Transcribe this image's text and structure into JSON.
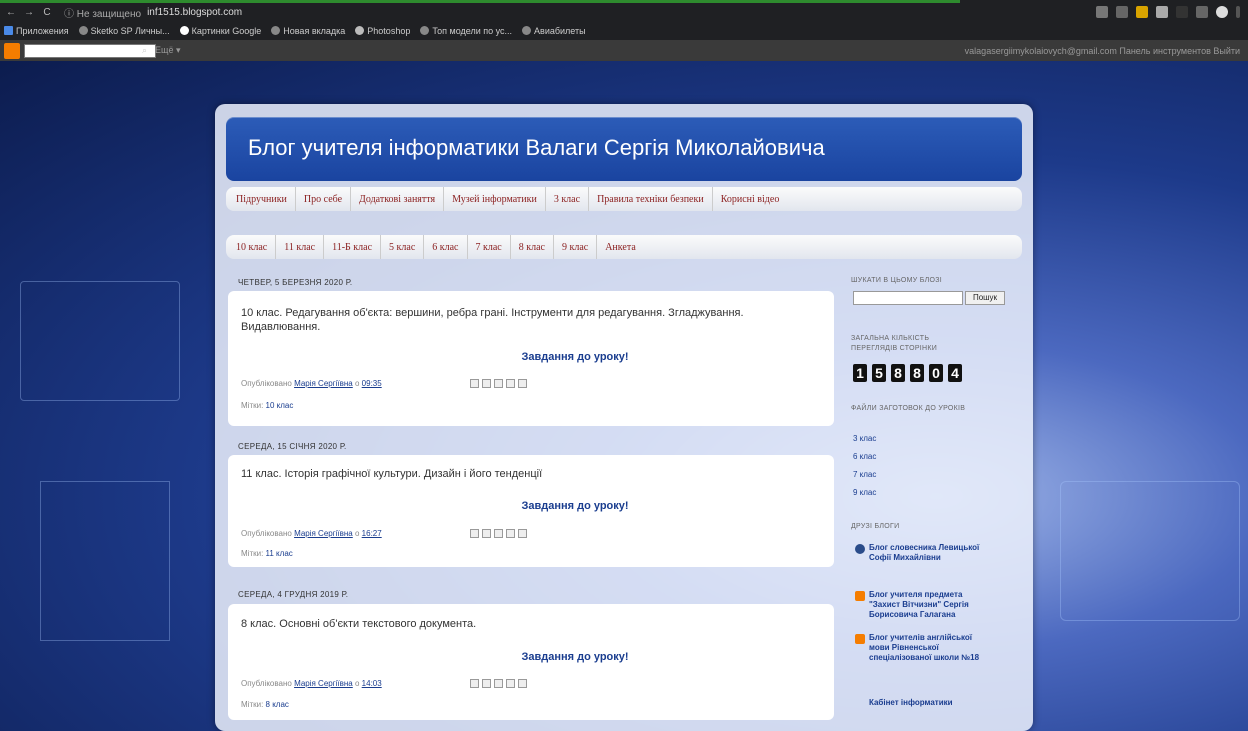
{
  "browser": {
    "nav_icons": [
      "←",
      "→",
      "C"
    ],
    "security_label": "ⓘ Не защищено",
    "url": "inf1515.blogspot.com",
    "bookmarks": [
      "Приложения",
      "Sketko SP Личны...",
      "Картинки Google",
      "Новая вкладка",
      "Photoshop",
      "Топ модели по ус...",
      "Авиабилеты"
    ]
  },
  "blogger_nav": {
    "search_icon": "magnifier-icon",
    "more_label": "Ещё ▾",
    "right_text": "valagasergiimykolaiovych@gmail.com   Панель инструментов   Выйти"
  },
  "blog": {
    "title": "Блог учителя інформатики Валаги Сергія Миколайовича",
    "tabs1": [
      "Підручники",
      "Про себе",
      "Додаткові заняття",
      "Музей інформатики",
      "3 клас",
      "Правила техніки безпеки",
      "Корисні відео"
    ],
    "tabs2": [
      "10 клас",
      "11 клас",
      "11-Б клас",
      "5 клас",
      "6 клас",
      "7 клас",
      "8 клас",
      "9 клас",
      "Анкета"
    ]
  },
  "posts": [
    {
      "date": "ЧЕТВЕР, 5 БЕРЕЗНЯ 2020 Р.",
      "title": "10 клас. Редагування об'єкта: вершини, ребра грані. Інструменти для редагування. Згладжування. Видавлювання.",
      "task": "Завдання до уроку!",
      "meta_prefix": "Опубліковано ",
      "author": "Марія Сергіївна",
      "at": " о ",
      "time": "09:35",
      "labels_prefix": "Мітки: ",
      "label": "10 клас"
    },
    {
      "date": "СЕРЕДА, 15 СІЧНЯ 2020 Р.",
      "title": "11 клас. Історія графічної культури. Дизайн і його тенденції",
      "task": "Завдання до уроку!",
      "meta_prefix": "Опубліковано ",
      "author": "Марія Сергіївна",
      "at": " о ",
      "time": "16:27",
      "labels_prefix": "Мітки: ",
      "label": "11 клас"
    },
    {
      "date": "СЕРЕДА, 4 ГРУДНЯ 2019 Р.",
      "title": "8 клас. Основні об'єкти текстового документа.",
      "task": "Завдання до уроку!",
      "meta_prefix": "Опубліковано ",
      "author": "Марія Сергіївна",
      "at": " о ",
      "time": "14:03",
      "labels_prefix": "Мітки: ",
      "label": "8 клас"
    }
  ],
  "sidebar": {
    "search_heading": "ШУКАТИ В ЦЬОМУ БЛОЗІ",
    "search_button": "Пошук",
    "views_heading": "ЗАГАЛЬНА КІЛЬКІСТЬ ПЕРЕГЛЯДІВ СТОРІНКИ",
    "views_digits": [
      "1",
      "5",
      "8",
      "8",
      "0",
      "4"
    ],
    "prep_heading": "ФАЙЛИ ЗАГОТОВОК ДО УРОКІВ",
    "prep_links": [
      "3 клас",
      "6 клас",
      "7 клас",
      "9 клас"
    ],
    "blogs_heading": "ДРУЗІ БЛОГИ",
    "blogs": [
      {
        "icon": "wordpress-icon",
        "text": "Блог словесника Левицької Софії Михайлівни"
      },
      {
        "icon": "blogger-icon",
        "text": "Блог учителя предмета \"Захист Вітчизни\" Сергія Борисовича Галагана"
      },
      {
        "icon": "blogger-icon",
        "text": "Блог учителів англійської мови Рівненської спеціалізованої школи №18"
      }
    ],
    "last_link": "Кабінет інформатики"
  },
  "colors": {
    "header": "#1a44a0",
    "tab_text": "#8b1f1f",
    "link": "#1a3d8f",
    "blogger_orange": "#f57d00"
  }
}
